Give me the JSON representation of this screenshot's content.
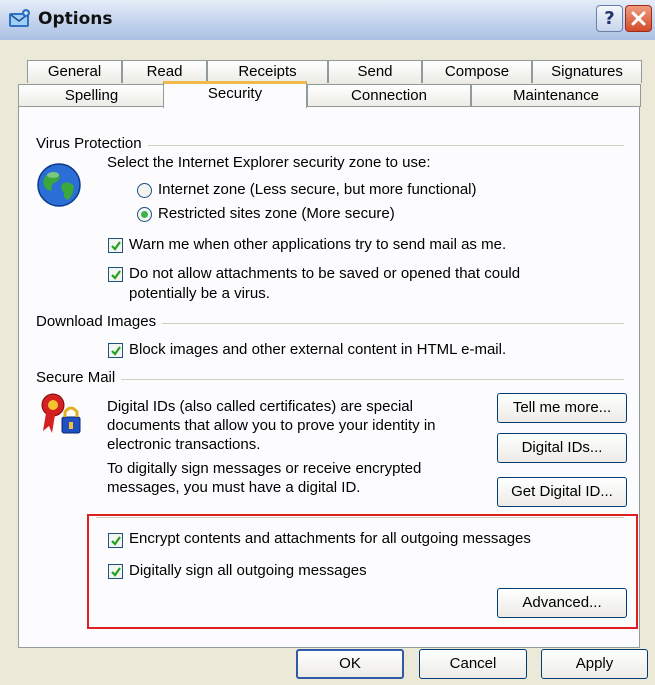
{
  "window": {
    "title": "Options",
    "help_glyph": "?"
  },
  "tabs_row1": [
    "General",
    "Read",
    "Receipts",
    "Send",
    "Compose",
    "Signatures"
  ],
  "tabs_row2": [
    "Spelling",
    "Security",
    "Connection",
    "Maintenance"
  ],
  "active_tab": "Security",
  "virus": {
    "title": "Virus Protection",
    "zone_prompt": "Select the Internet Explorer security zone to use:",
    "zone_internet": "Internet zone (Less secure, but more functional)",
    "zone_restricted": "Restricted sites zone (More secure)",
    "selected_zone": "restricted",
    "warn_label": "Warn me when other applications try to send mail as me.",
    "warn_checked": true,
    "attach_label_1": "Do not allow attachments to be saved or opened that could",
    "attach_label_2": "potentially be a virus.",
    "attach_checked": true
  },
  "download": {
    "title": "Download Images",
    "block_label": "Block images and other external content in HTML e-mail.",
    "block_checked": true
  },
  "secure": {
    "title": "Secure Mail",
    "desc1_l1": "Digital IDs (also called certificates) are special",
    "desc1_l2": "documents that allow you to prove your identity in",
    "desc1_l3": "electronic transactions.",
    "desc2_l1": "To digitally sign messages or receive encrypted",
    "desc2_l2": "messages, you must have a digital ID.",
    "tell_more": "Tell me more...",
    "digital_ids": "Digital IDs...",
    "get_id": "Get Digital ID...",
    "encrypt_label": "Encrypt contents and attachments for all outgoing messages",
    "encrypt_checked": true,
    "sign_label": "Digitally sign all outgoing messages",
    "sign_checked": true,
    "advanced": "Advanced..."
  },
  "footer": {
    "ok": "OK",
    "cancel": "Cancel",
    "apply": "Apply"
  }
}
